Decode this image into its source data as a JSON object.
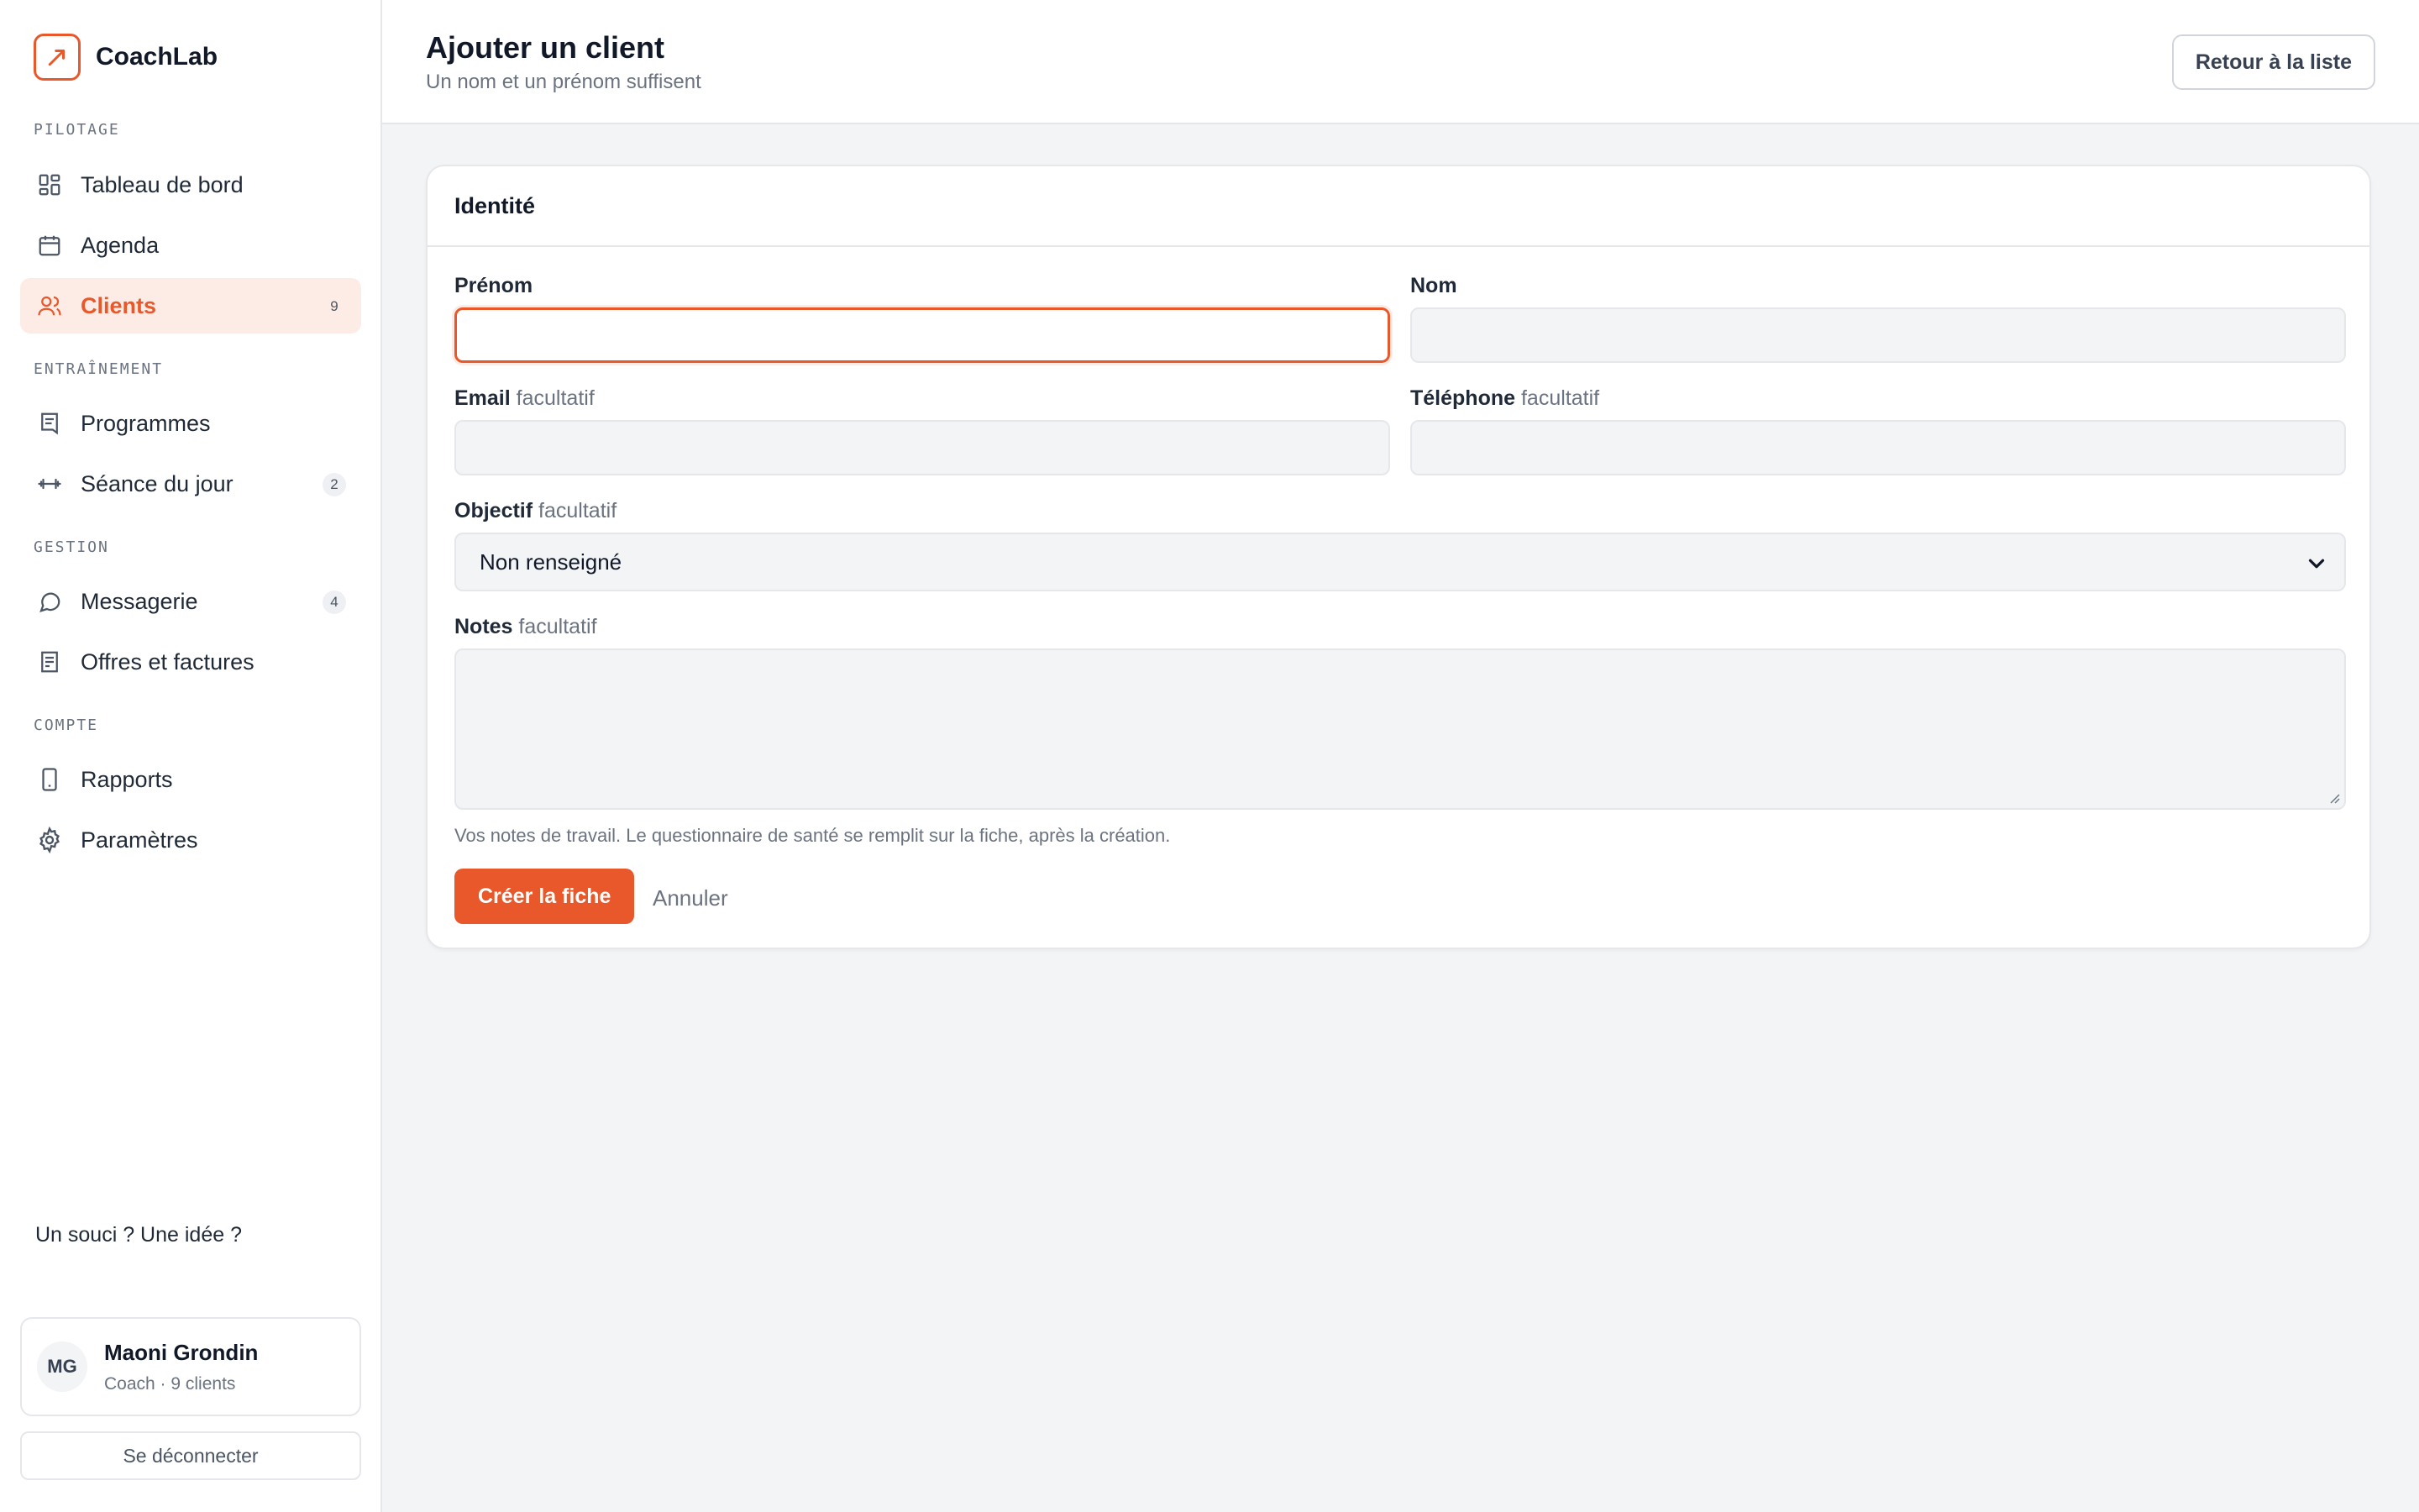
{
  "brand": {
    "name": "CoachLab"
  },
  "sidebar": {
    "sections": [
      {
        "label": "PILOTAGE"
      },
      {
        "label": "ENTRAÎNEMENT"
      },
      {
        "label": "GESTION"
      },
      {
        "label": "COMPTE"
      }
    ],
    "items": [
      {
        "label": "Tableau de bord",
        "icon": "dashboard-icon"
      },
      {
        "label": "Agenda",
        "icon": "calendar-icon"
      },
      {
        "label": "Clients",
        "icon": "users-icon",
        "badge": "9",
        "active": true
      },
      {
        "label": "Programmes",
        "icon": "document-icon"
      },
      {
        "label": "Séance du jour",
        "icon": "dumbbell-icon",
        "badge": "2"
      },
      {
        "label": "Messagerie",
        "icon": "chat-icon",
        "badge": "4"
      },
      {
        "label": "Offres et factures",
        "icon": "invoice-icon"
      },
      {
        "label": "Rapports",
        "icon": "phone-icon"
      },
      {
        "label": "Paramètres",
        "icon": "gear-icon"
      }
    ],
    "feedback": "Un souci ? Une idée ?",
    "user": {
      "initials": "MG",
      "name": "Maoni Grondin",
      "role": "Coach · 9 clients"
    },
    "logout": "Se déconnecter"
  },
  "header": {
    "title": "Ajouter un client",
    "subtitle": "Un nom et un prénom suffisent",
    "back_button": "Retour à la liste"
  },
  "form": {
    "section_title": "Identité",
    "optional_tag": "facultatif",
    "first_name": {
      "label": "Prénom",
      "value": ""
    },
    "last_name": {
      "label": "Nom",
      "value": ""
    },
    "email": {
      "label": "Email",
      "value": ""
    },
    "phone": {
      "label": "Téléphone",
      "value": ""
    },
    "goal": {
      "label": "Objectif",
      "selected": "Non renseigné"
    },
    "notes": {
      "label": "Notes",
      "value": "",
      "help": "Vos notes de travail. Le questionnaire de santé se remplit sur la fiche, après la création."
    },
    "submit": "Créer la fiche",
    "cancel": "Annuler"
  },
  "colors": {
    "accent": "#e8582a",
    "accent_soft": "#fdece6"
  }
}
